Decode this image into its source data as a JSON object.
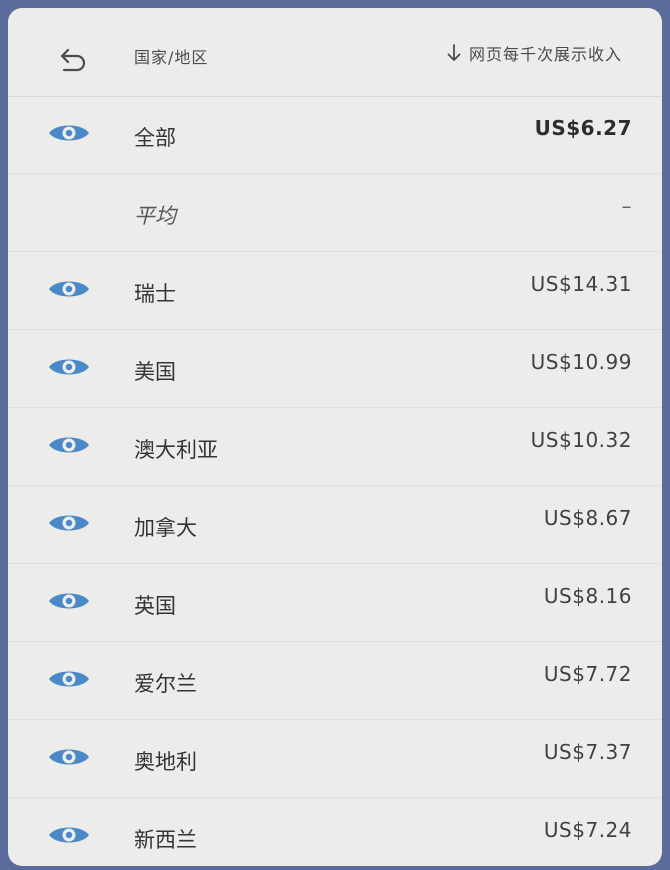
{
  "header": {
    "back_icon": "undo-arrow-icon",
    "column_label": "国家/地区",
    "sort_icon": "arrow-down-icon",
    "sort_label": "网页每千次展示收入"
  },
  "colors": {
    "eye_icon": "#4a88c8",
    "background": "#ecedea",
    "frame": "#5a6b9c"
  },
  "rows": [
    {
      "name": "全部",
      "value": "US$6.27",
      "icon": "eye-icon"
    },
    {
      "name": "平均",
      "value": "–",
      "icon": ""
    },
    {
      "name": "瑞士",
      "value": "US$14.31",
      "icon": "eye-icon"
    },
    {
      "name": "美国",
      "value": "US$10.99",
      "icon": "eye-icon"
    },
    {
      "name": "澳大利亚",
      "value": "US$10.32",
      "icon": "eye-icon"
    },
    {
      "name": "加拿大",
      "value": "US$8.67",
      "icon": "eye-icon"
    },
    {
      "name": "英国",
      "value": "US$8.16",
      "icon": "eye-icon"
    },
    {
      "name": "爱尔兰",
      "value": "US$7.72",
      "icon": "eye-icon"
    },
    {
      "name": "奥地利",
      "value": "US$7.37",
      "icon": "eye-icon"
    },
    {
      "name": "新西兰",
      "value": "US$7.24",
      "icon": "eye-icon"
    }
  ]
}
